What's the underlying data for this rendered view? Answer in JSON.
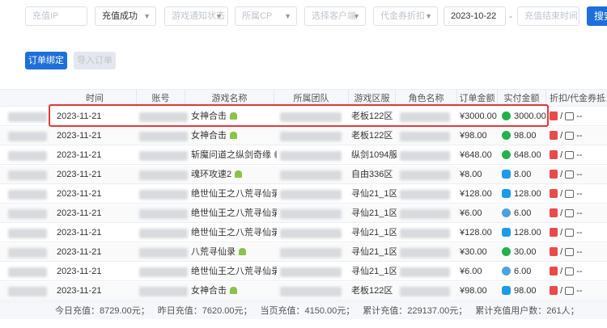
{
  "filters": {
    "ip_placeholder": "充值IP",
    "status_value": "充值成功",
    "game_notify_placeholder": "游戏通知状态",
    "cp_placeholder": "所属CP",
    "client_placeholder": "选择客户端",
    "voucher_placeholder": "代金券折扣",
    "start_date": "2023-10-22",
    "date_separator": "-",
    "end_date_placeholder": "充值结束时间",
    "search_label": "搜索"
  },
  "toolbar": {
    "bind_order_label": "订单绑定",
    "import_order_label": "导入订单"
  },
  "table": {
    "headers": [
      "时间",
      "账号",
      "游戏名称",
      "所属团队",
      "游戏区服",
      "角色名称",
      "订单金额",
      "实付金额",
      "折扣/代金券抵扣"
    ],
    "rows": [
      {
        "time": "2023-11-21",
        "game": "女神合击",
        "platform": "android",
        "server": "老板122区",
        "amount": "¥3000.00",
        "paid": "3000.00",
        "pay": "wx",
        "deduct": "/",
        "dash": "--"
      },
      {
        "time": "2023-11-21",
        "game": "女神合击",
        "platform": "android",
        "server": "老板122区",
        "amount": "¥98.00",
        "paid": "98.00",
        "pay": "wx",
        "deduct": "/",
        "dash": "--"
      },
      {
        "time": "2023-11-21",
        "game": "斩魔问道之纵剑奇缘",
        "platform": "apple",
        "server": "纵剑1094服",
        "amount": "¥648.00",
        "paid": "648.00",
        "pay": "wx",
        "deduct": "/",
        "dash": "--"
      },
      {
        "time": "2023-11-21",
        "game": "魂环攻速2",
        "platform": "android",
        "server": "自由336区",
        "amount": "¥8.00",
        "paid": "8.00",
        "pay": "ali",
        "deduct": "/",
        "dash": "--"
      },
      {
        "time": "2023-11-21",
        "game": "绝世仙王之八荒寻仙录",
        "platform": "android",
        "server": "寻仙21_1区",
        "amount": "¥128.00",
        "paid": "128.00",
        "pay": "ali",
        "deduct": "/",
        "dash": "--"
      },
      {
        "time": "2023-11-21",
        "game": "绝世仙王之八荒寻仙录",
        "platform": "android",
        "server": "寻仙21_1区",
        "amount": "¥6.00",
        "paid": "6.00",
        "pay": "other",
        "deduct": "/",
        "dash": "--"
      },
      {
        "time": "2023-11-21",
        "game": "绝世仙王之八荒寻仙录",
        "platform": "android",
        "server": "寻仙21_1区",
        "amount": "¥128.00",
        "paid": "128.00",
        "pay": "ali",
        "deduct": "/",
        "dash": "--"
      },
      {
        "time": "2023-11-21",
        "game": "八荒寻仙录",
        "platform": "android",
        "server": "寻仙21_1区",
        "amount": "¥30.00",
        "paid": "30.00",
        "pay": "wx",
        "deduct": "/",
        "dash": "--"
      },
      {
        "time": "2023-11-21",
        "game": "绝世仙王之八荒寻仙录",
        "platform": "android",
        "server": "寻仙21_1区",
        "amount": "¥6.00",
        "paid": "6.00",
        "pay": "other",
        "deduct": "/",
        "dash": "--"
      },
      {
        "time": "2023-11-21",
        "game": "女神合击",
        "platform": "android",
        "server": "老板122区",
        "amount": "¥98.00",
        "paid": "98.00",
        "pay": "ali",
        "deduct": "/",
        "dash": "--"
      }
    ]
  },
  "footer": {
    "today": "今日充值：8729.00元；",
    "yesterday": "昨日充值：7620.00元；",
    "page": "当页充值：4150.00元；",
    "total": "累计充值：229137.00元；",
    "users": "累计充值用户数：261人；"
  },
  "colors": {
    "primary": "#1e6fd9",
    "highlight": "#e03a3a",
    "wechat": "#22b14c",
    "alipay": "#1e9be8"
  }
}
